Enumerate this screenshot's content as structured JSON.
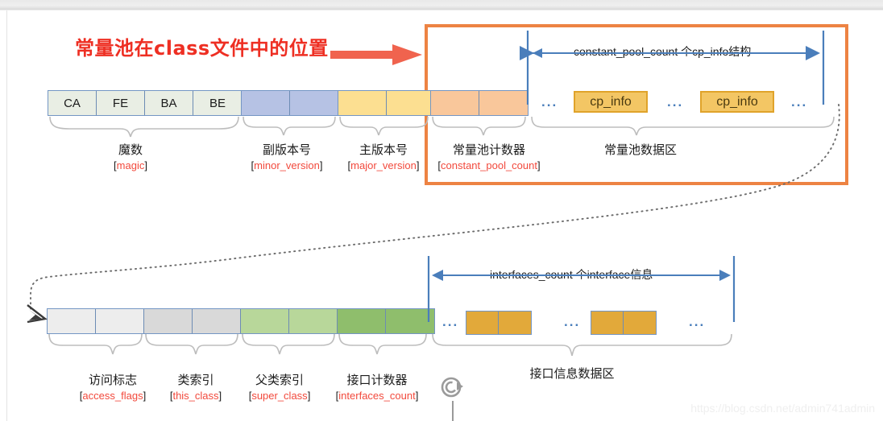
{
  "title": "常量池在class文件中的位置",
  "highlight_color": "#ed8343",
  "accent_red": "#ee2f23",
  "watermark": "https://blog.csdn.net/admin741admin",
  "top_row": {
    "magic_cells": [
      "CA",
      "FE",
      "BA",
      "BE"
    ],
    "minor_cells": [
      "",
      ""
    ],
    "major_cells": [
      "",
      ""
    ],
    "cpcount_cells": [
      "",
      ""
    ],
    "range_label": "constant_pool_count 个cp_info结构",
    "chips": [
      "cp_info",
      "cp_info"
    ],
    "dots": [
      "...",
      "...",
      "..."
    ],
    "captions": [
      {
        "cn": "魔数",
        "en": "magic"
      },
      {
        "cn": "副版本号",
        "en": "minor_version"
      },
      {
        "cn": "主版本号",
        "en": "major_version"
      },
      {
        "cn": "常量池计数器",
        "en": "constant_pool_count"
      },
      {
        "cn": "常量池数据区",
        "en": ""
      }
    ]
  },
  "bottom_row": {
    "cells": [
      "",
      "",
      "",
      "",
      "",
      "",
      "",
      ""
    ],
    "range_label": "interfaces_count 个interface信息",
    "dots": [
      "...",
      "...",
      "..."
    ],
    "area_caption": "接口信息数据区",
    "captions": [
      {
        "cn": "访问标志",
        "en": "access_flags"
      },
      {
        "cn": "类索引",
        "en": "this_class"
      },
      {
        "cn": "父类索引",
        "en": "super_class"
      },
      {
        "cn": "接口计数器",
        "en": "interfaces_count"
      }
    ]
  },
  "icons": {
    "refresh": "refresh-icon",
    "arrow_right": "arrow-right-icon"
  }
}
